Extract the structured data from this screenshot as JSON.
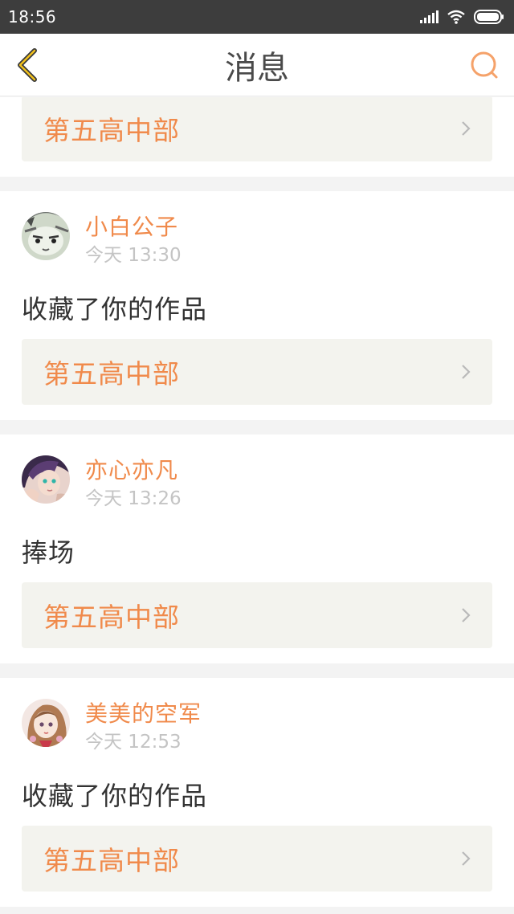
{
  "status_bar": {
    "time": "18:56"
  },
  "nav": {
    "title": "消息"
  },
  "colors": {
    "accent": "#f08a4b",
    "card_link_bg": "#f3f3ee"
  },
  "partial_card": {
    "work_title": "第五高中部"
  },
  "messages": [
    {
      "username": "小白公子",
      "time": "今天 13:30",
      "action": "收藏了你的作品",
      "work_title": "第五高中部",
      "avatar_icon": "cat-avatar-icon"
    },
    {
      "username": "亦心亦凡",
      "time": "今天 13:26",
      "action": "捧场",
      "work_title": "第五高中部",
      "avatar_icon": "girl-avatar-icon"
    },
    {
      "username": "美美的空军",
      "time": "今天 12:53",
      "action": "收藏了你的作品",
      "work_title": "第五高中部",
      "avatar_icon": "anime-girl-avatar-icon"
    }
  ]
}
